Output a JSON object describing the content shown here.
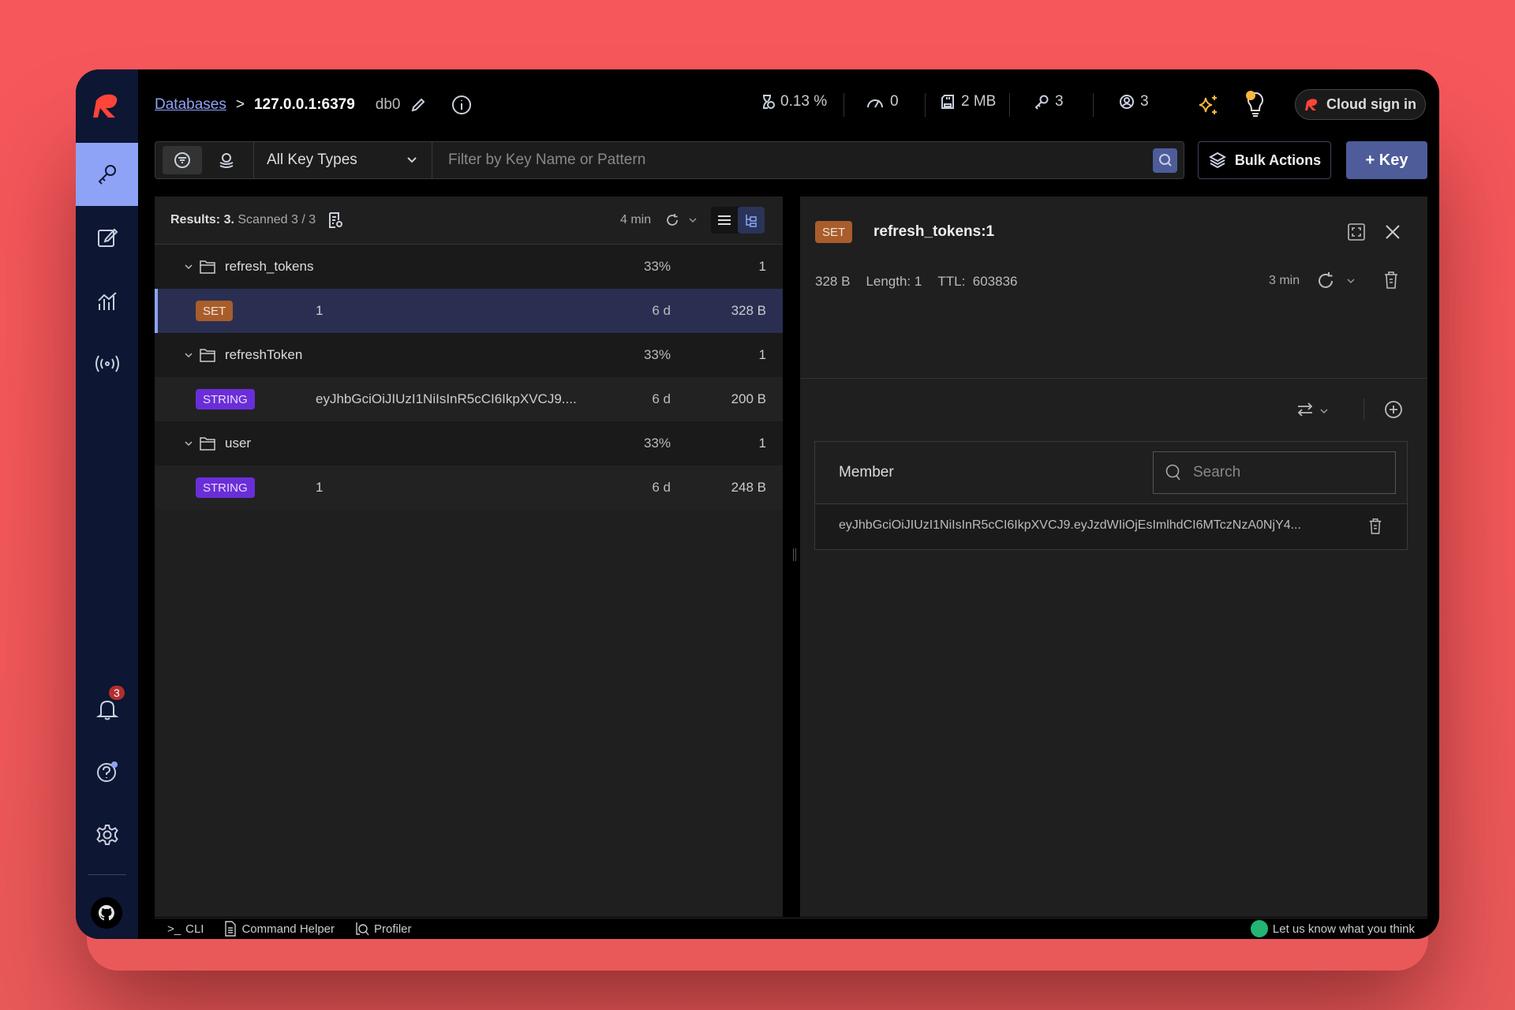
{
  "breadcrumb": {
    "databases": "Databases",
    "separator": ">",
    "host": "127.0.0.1:6379",
    "db": "db0"
  },
  "stats": {
    "cpu": "0.13 %",
    "ops": "0",
    "memory": "2 MB",
    "keys": "3",
    "clients": "3"
  },
  "cloud_sign_in": "Cloud sign in",
  "filter": {
    "key_type": "All Key Types",
    "placeholder": "Filter by Key Name or Pattern"
  },
  "bulk_actions": "Bulk Actions",
  "add_key": "+ Key",
  "notifications_count": "3",
  "list": {
    "results_label": "Results: 3.",
    "scanned": "Scanned 3 / 3",
    "refreshed": "4 min",
    "rows": [
      {
        "kind": "folder",
        "name": "refresh_tokens",
        "percent": "33%",
        "count": "1"
      },
      {
        "kind": "key",
        "type": "SET",
        "name": "1",
        "ttl": "6 d",
        "size": "328 B",
        "selected": true
      },
      {
        "kind": "folder",
        "name": "refreshToken",
        "percent": "33%",
        "count": "1"
      },
      {
        "kind": "key",
        "type": "STRING",
        "name": "eyJhbGciOiJIUzI1NiIsInR5cCI6IkpXVCJ9....",
        "ttl": "6 d",
        "size": "200 B"
      },
      {
        "kind": "folder",
        "name": "user",
        "percent": "33%",
        "count": "1"
      },
      {
        "kind": "key",
        "type": "STRING",
        "name": "1",
        "ttl": "6 d",
        "size": "248 B"
      }
    ]
  },
  "detail": {
    "type": "SET",
    "key": "refresh_tokens:1",
    "size": "328 B",
    "length": "Length: 1",
    "ttl_label": "TTL:",
    "ttl": "603836",
    "refreshed": "3 min",
    "column": "Member",
    "search_placeholder": "Search",
    "members": [
      "eyJhbGciOiJIUzI1NiIsInR5cCI6IkpXVCJ9.eyJzdWIiOjEsImlhdCI6MTczNzA0NjY4..."
    ]
  },
  "bottom": {
    "cli": "CLI",
    "command_helper": "Command Helper",
    "profiler": "Profiler",
    "feedback": "Let us know what you think"
  },
  "colors": {
    "accent": "#8ea3f5",
    "set": "#a85d2b",
    "string": "#6a2ed8",
    "background": "#f6575b"
  }
}
